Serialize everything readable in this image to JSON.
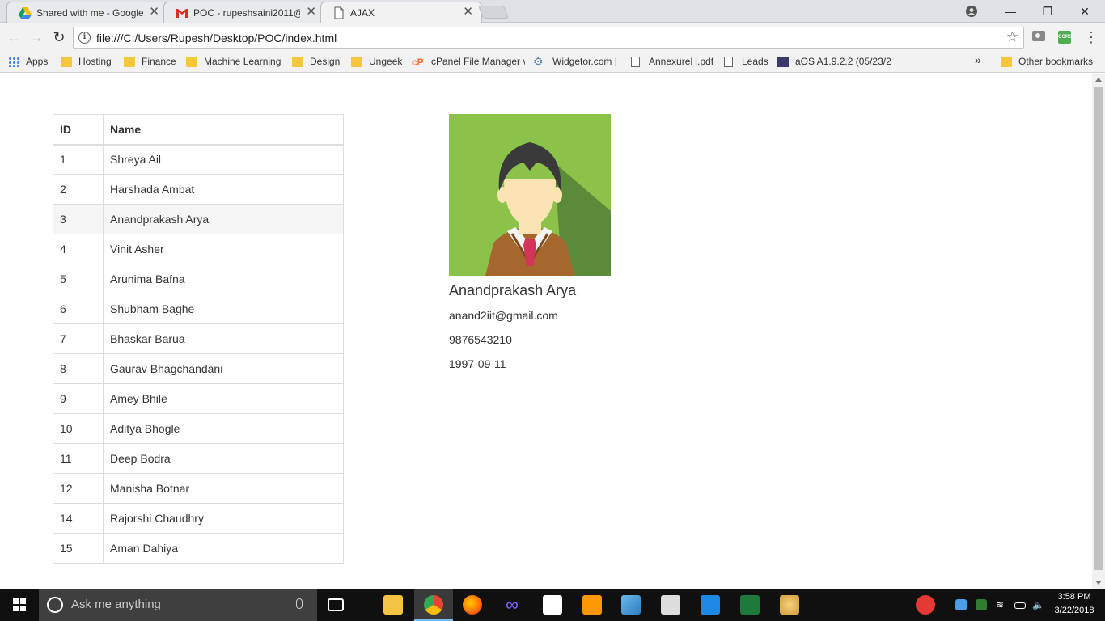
{
  "browser": {
    "tabs": [
      {
        "title": "Shared with me - Google",
        "icon": "google-drive-icon"
      },
      {
        "title": "POC - rupeshsaini2011@",
        "icon": "gmail-icon"
      },
      {
        "title": "AJAX",
        "icon": "page-icon"
      }
    ],
    "close_glyph": "✕",
    "url": "file:///C:/Users/Rupesh/Desktop/POC/index.html",
    "bookmarks": [
      {
        "label": "Apps",
        "icon": "apps-grid-icon"
      },
      {
        "label": "Hosting",
        "icon": "folder-icon"
      },
      {
        "label": "Finance",
        "icon": "folder-icon"
      },
      {
        "label": "Machine Learning",
        "icon": "folder-icon"
      },
      {
        "label": "Design",
        "icon": "folder-icon"
      },
      {
        "label": "Ungeek",
        "icon": "folder-icon"
      },
      {
        "label": "cPanel File Manager v",
        "icon": "cpanel-icon"
      },
      {
        "label": "Widgetor.com |",
        "icon": "gear-icon"
      },
      {
        "label": "AnnexureH.pdf",
        "icon": "document-icon"
      },
      {
        "label": "Leads",
        "icon": "document-icon"
      },
      {
        "label": "aOS A1.9.2.2 (05/23/2",
        "icon": "aos-icon"
      }
    ],
    "overflow_glyph": "»",
    "other_bookmarks": "Other bookmarks"
  },
  "table": {
    "headers": {
      "id": "ID",
      "name": "Name"
    },
    "rows": [
      {
        "id": "1",
        "name": "Shreya Ail"
      },
      {
        "id": "2",
        "name": "Harshada Ambat"
      },
      {
        "id": "3",
        "name": "Anandprakash Arya"
      },
      {
        "id": "4",
        "name": "Vinit Asher"
      },
      {
        "id": "5",
        "name": "Arunima Bafna"
      },
      {
        "id": "6",
        "name": "Shubham Baghe"
      },
      {
        "id": "7",
        "name": "Bhaskar Barua"
      },
      {
        "id": "8",
        "name": "Gaurav Bhagchandani"
      },
      {
        "id": "9",
        "name": "Amey Bhile"
      },
      {
        "id": "10",
        "name": "Aditya Bhogle"
      },
      {
        "id": "11",
        "name": "Deep Bodra"
      },
      {
        "id": "12",
        "name": "Manisha Botnar"
      },
      {
        "id": "14",
        "name": "Rajorshi Chaudhry"
      },
      {
        "id": "15",
        "name": "Aman Dahiya"
      }
    ],
    "selected_id": "3"
  },
  "profile": {
    "name": "Anandprakash Arya",
    "email": "anand2iit@gmail.com",
    "phone": "9876543210",
    "dob": "1997-09-11",
    "colors": {
      "bg_light": "#8bc34a",
      "bg_shadow": "#5a8a3a",
      "sweater": "#a5672d",
      "skin": "#fce3b4",
      "hair": "#3a3a3a",
      "tie": "#d6335a"
    }
  },
  "taskbar": {
    "search_placeholder": "Ask me anything",
    "time": "3:58 PM",
    "date": "3/22/2018"
  }
}
